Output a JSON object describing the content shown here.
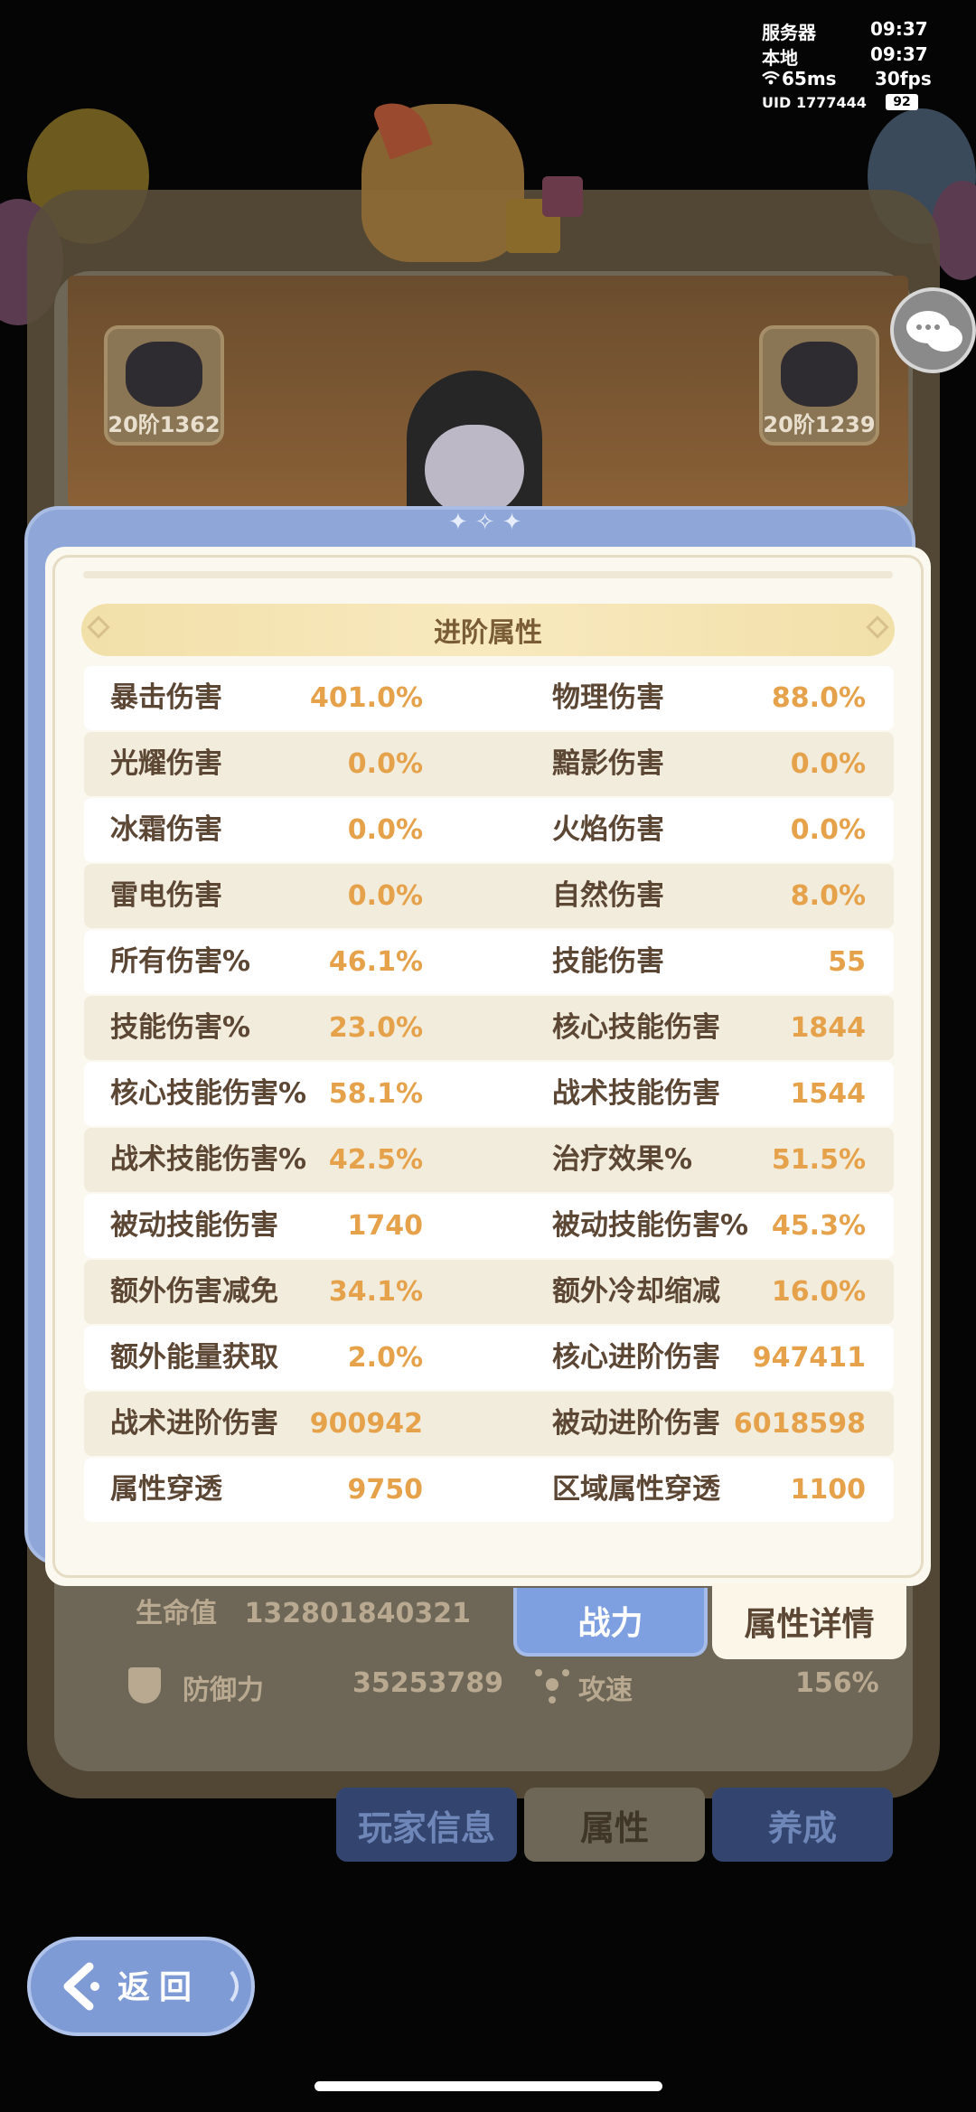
{
  "status": {
    "server_label": "服务器",
    "server_time": "09:37",
    "local_label": "本地",
    "local_time": "09:37",
    "ping": "65ms",
    "fps": "30fps",
    "uid_label": "UID",
    "uid": "1777444",
    "battery": "92"
  },
  "badges": {
    "left_level": "20阶1362",
    "right_level": "20阶1239"
  },
  "background": {
    "life_label": "生命值",
    "life_value": "132801840321",
    "defense_label": "防御力",
    "defense_value": "35253789",
    "speed_label": "攻速",
    "speed_value": "156%",
    "tabs": [
      "玩家信息",
      "属性",
      "养成"
    ]
  },
  "modal": {
    "section_title": "进阶属性",
    "rows": [
      {
        "l_label": "暴击伤害",
        "l_value": "401.0%",
        "r_label": "物理伤害",
        "r_value": "88.0%"
      },
      {
        "l_label": "光耀伤害",
        "l_value": "0.0%",
        "r_label": "黯影伤害",
        "r_value": "0.0%"
      },
      {
        "l_label": "冰霜伤害",
        "l_value": "0.0%",
        "r_label": "火焰伤害",
        "r_value": "0.0%"
      },
      {
        "l_label": "雷电伤害",
        "l_value": "0.0%",
        "r_label": "自然伤害",
        "r_value": "8.0%"
      },
      {
        "l_label": "所有伤害%",
        "l_value": "46.1%",
        "r_label": "技能伤害",
        "r_value": "55"
      },
      {
        "l_label": "技能伤害%",
        "l_value": "23.0%",
        "r_label": "核心技能伤害",
        "r_value": "1844"
      },
      {
        "l_label": "核心技能伤害%",
        "l_value": "58.1%",
        "r_label": "战术技能伤害",
        "r_value": "1544"
      },
      {
        "l_label": "战术技能伤害%",
        "l_value": "42.5%",
        "r_label": "治疗效果%",
        "r_value": "51.5%"
      },
      {
        "l_label": "被动技能伤害",
        "l_value": "1740",
        "r_label": "被动技能伤害%",
        "r_value": "45.3%"
      },
      {
        "l_label": "额外伤害减免",
        "l_value": "34.1%",
        "r_label": "额外冷却缩减",
        "r_value": "16.0%"
      },
      {
        "l_label": "额外能量获取",
        "l_value": "2.0%",
        "r_label": "核心进阶伤害",
        "r_value": "947411"
      },
      {
        "l_label": "战术进阶伤害",
        "l_value": "900942",
        "r_label": "被动进阶伤害",
        "r_value": "6018598"
      },
      {
        "l_label": "属性穿透",
        "l_value": "9750",
        "r_label": "区域属性穿透",
        "r_value": "1100"
      }
    ],
    "tab_combat": "战力",
    "tab_detail": "属性详情"
  },
  "back_button": "返回"
}
